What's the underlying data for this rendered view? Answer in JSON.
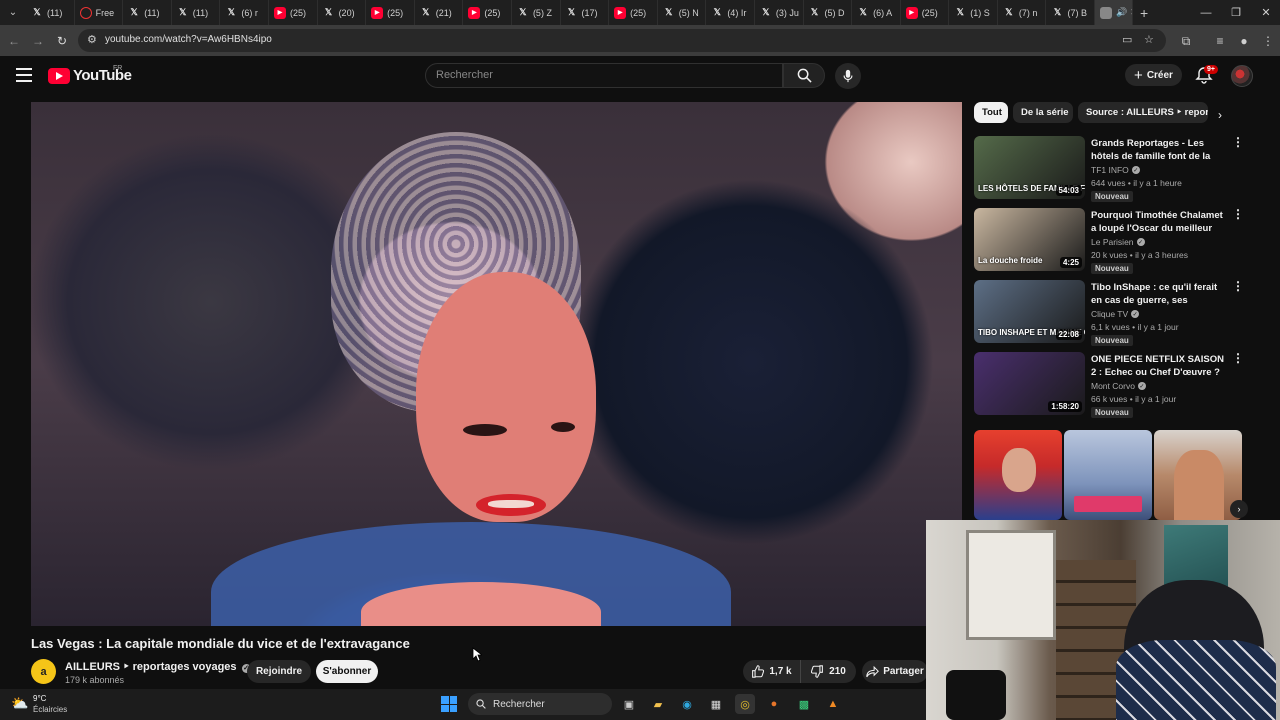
{
  "browser": {
    "tabs": [
      {
        "label": "(11)",
        "icon": "x-icon"
      },
      {
        "label": "Free",
        "icon": "free-icon"
      },
      {
        "label": "(11)",
        "icon": "x-icon"
      },
      {
        "label": "(11)",
        "icon": "x-icon"
      },
      {
        "label": "(6) r",
        "icon": "x-icon"
      },
      {
        "label": "(25)",
        "icon": "youtube-icon"
      },
      {
        "label": "(20)",
        "icon": "x-icon"
      },
      {
        "label": "(25)",
        "icon": "youtube-icon"
      },
      {
        "label": "(21)",
        "icon": "x-icon"
      },
      {
        "label": "(25)",
        "icon": "youtube-icon"
      },
      {
        "label": "(5) Z",
        "icon": "x-icon"
      },
      {
        "label": "(17)",
        "icon": "x-icon"
      },
      {
        "label": "(25)",
        "icon": "youtube-icon"
      },
      {
        "label": "(5) N",
        "icon": "x-icon"
      },
      {
        "label": "(4) Ir",
        "icon": "x-icon"
      },
      {
        "label": "(3) Ju",
        "icon": "x-icon"
      },
      {
        "label": "(5) D",
        "icon": "x-icon"
      },
      {
        "label": "(6) A",
        "icon": "x-icon"
      },
      {
        "label": "(25)",
        "icon": "youtube-icon"
      },
      {
        "label": "(1) S",
        "icon": "x-icon"
      },
      {
        "label": "(7) n",
        "icon": "x-icon"
      },
      {
        "label": "(7) B",
        "icon": "x-icon"
      }
    ],
    "url": "youtube.com/watch?v=Aw6HBNs4ipo"
  },
  "header": {
    "logo_text": "YouTube",
    "country": "FR",
    "search_placeholder": "Rechercher",
    "create_label": "Créer",
    "notif_count": "9+"
  },
  "video": {
    "title": "Las Vegas : La capitale mondiale du vice et de l'extravagance",
    "channel": "AILLEURS ‣ reportages voyages",
    "channel_initial": "a",
    "subscribers": "179 k abonnés",
    "join_label": "Rejoindre",
    "subscribe_label": "S'abonner",
    "likes": "1,7 k",
    "dislikes": "210",
    "share_label": "Partager"
  },
  "sidebar": {
    "chips": [
      "Tout",
      "De la série",
      "Source : AILLEURS ‣ reportages voyages"
    ],
    "recommendations": [
      {
        "title": "Grands Reportages - Les hôtels de famille font de la résistance...",
        "channel": "TF1 INFO",
        "meta": "644 vues • il y a 1 heure",
        "badge": "Nouveau",
        "duration": "54:03",
        "thumb_text": "LES HÔTELS DE FAMILLE FONT DE LA RÉSISTANCE",
        "thumb_color": "#556b4a"
      },
      {
        "title": "Pourquoi Timothée Chalamet a loupé l'Oscar du meilleur acteur",
        "channel": "Le Parisien",
        "meta": "20 k vues • il y a 3 heures",
        "badge": "Nouveau",
        "duration": "4:25",
        "thumb_text": "La douche froide",
        "thumb_color": "#c9b7a0"
      },
      {
        "title": "Tibo InShape : ce qu'il ferait en cas de guerre, ses revenus, les...",
        "channel": "Clique TV",
        "meta": "6,1 k vues • il y a 1 jour",
        "badge": "Nouveau",
        "duration": "22:08",
        "thumb_text": "TIBO INSHAPE ET MAXIME GROUSSET",
        "thumb_color": "#5d6f86"
      },
      {
        "title": "ONE PIECE NETFLIX SAISON 2 : Echec ou Chef D'œuvre ? ...",
        "channel": "Mont Corvo",
        "meta": "66 k vues • il y a 1 jour",
        "badge": "Nouveau",
        "duration": "1:58:20",
        "thumb_text": "",
        "thumb_color": "#4a2f6e"
      }
    ]
  },
  "taskbar": {
    "temperature": "9°C",
    "weather": "Éclaircies",
    "search_label": "Rechercher"
  }
}
